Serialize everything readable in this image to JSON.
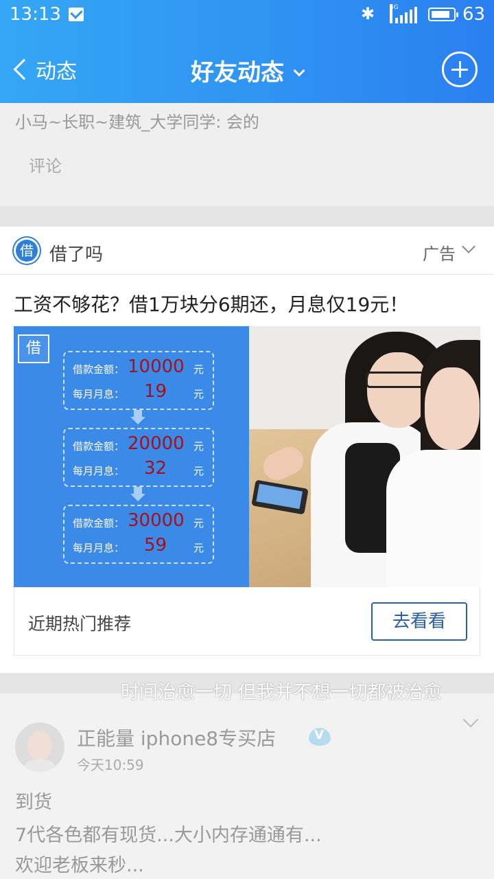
{
  "status_bar": {
    "time": "13:13",
    "network": "4G",
    "battery": "63"
  },
  "header": {
    "back_label": "动态",
    "title": "好友动态"
  },
  "prev_comment": {
    "text": "小马~长职~建筑_大学同学: 会的",
    "comment_button": "评论"
  },
  "ad": {
    "advertiser": "借了吗",
    "logo_char": "借",
    "tag": "广告",
    "headline": "工资不够花？借1万块分6期还，月息仅19元！",
    "loan_rows": [
      {
        "amount_label": "借款金额：",
        "amount": "10000",
        "unit": "元",
        "interest_label": "每月月息：",
        "interest": "19",
        "interest_unit": "元"
      },
      {
        "amount_label": "借款金额：",
        "amount": "20000",
        "unit": "元",
        "interest_label": "每月月息：",
        "interest": "32",
        "interest_unit": "元"
      },
      {
        "amount_label": "借款金额：",
        "amount": "30000",
        "unit": "元",
        "interest_label": "每月月息：",
        "interest": "59",
        "interest_unit": "元"
      }
    ],
    "footer_text": "近期热门推荐",
    "cta_label": "去看看"
  },
  "watermark_text": "时间治愈一切 但我并不想一切都被治愈",
  "post": {
    "username": "正能量  iphone8专买店",
    "time": "今天10:59",
    "lines": [
      "到货",
      "7代各色都有现货...大小内存通通有...",
      "欢迎老板来秒..."
    ]
  },
  "colors": {
    "header_start": "#35a6f5",
    "header_end": "#2b7ff0",
    "ad_blue": "#3c8ae8",
    "loan_number": "#a3121a",
    "cta_border": "#2c5f9e"
  }
}
